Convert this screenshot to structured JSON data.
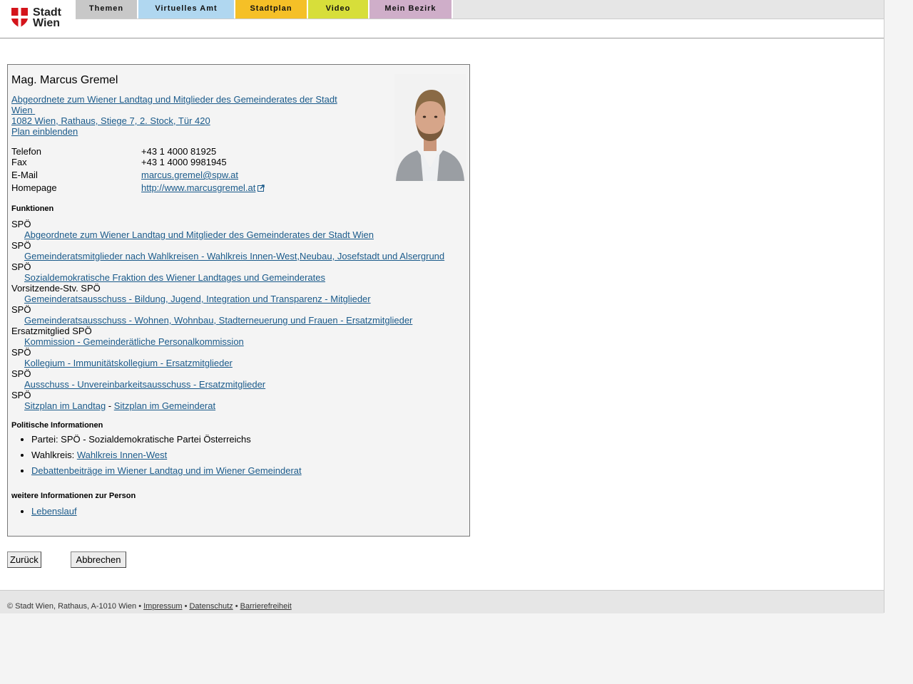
{
  "header": {
    "logo_text": "Stadt\nWien",
    "tabs": [
      {
        "label": "Themen",
        "color": "#c8c8c8"
      },
      {
        "label": "Virtuelles Amt",
        "color": "#b0d7f0"
      },
      {
        "label": "Stadtplan",
        "color": "#f5c027"
      },
      {
        "label": "Video",
        "color": "#d7de3a"
      },
      {
        "label": "Mein Bezirk",
        "color": "#cfaec9"
      }
    ]
  },
  "person": {
    "name": "Mag. Marcus Gremel",
    "title_line1": "Abgeordnete zum Wiener Landtag und Mitglieder des Gemeinderates der Stadt",
    "title_line2": "Wien",
    "address": "1082 Wien, Rathaus, Stiege 7, 2. Stock, Tür 420",
    "map_link": "Plan einblenden"
  },
  "contact": {
    "phone_label": "Telefon",
    "phone": "+43 1 4000 81925",
    "fax_label": "Fax",
    "fax": "+43 1 4000 9981945",
    "email_label": "E-Mail",
    "email": "marcus.gremel@spw.at",
    "homepage_label": "Homepage",
    "homepage": "http://www.marcusgremel.at"
  },
  "functions": {
    "heading": "Funktionen",
    "items": [
      {
        "role": "SPÖ",
        "link": "Abgeordnete zum Wiener Landtag und Mitglieder des Gemeinderates der Stadt Wien"
      },
      {
        "role": "SPÖ",
        "link": "Gemeinderatsmitglieder nach Wahlkreisen - Wahlkreis Innen-West,Neubau, Josefstadt und Alsergrund"
      },
      {
        "role": "SPÖ",
        "link": "Sozialdemokratische Fraktion des Wiener Landtages und Gemeinderates"
      },
      {
        "role": "Vorsitzende-Stv. SPÖ",
        "link": "Gemeinderatsausschuss - Bildung, Jugend, Integration und Transparenz - Mitglieder"
      },
      {
        "role": "SPÖ",
        "link": "Gemeinderatsausschuss - Wohnen, Wohnbau, Stadterneuerung und Frauen - Ersatzmitglieder"
      },
      {
        "role": "Ersatzmitglied SPÖ",
        "link": "Kommission - Gemeinderätliche Personalkommission"
      },
      {
        "role": "SPÖ",
        "link": "Kollegium - Immunitätskollegium - Ersatzmitglieder"
      },
      {
        "role": "SPÖ",
        "link": "Ausschuss - Unvereinbarkeitsausschuss - Ersatzmitglieder"
      }
    ],
    "last_role": "SPÖ",
    "seat_landtag": "Sitzplan im Landtag",
    "separator": " - ",
    "seat_gemeinderat": "Sitzplan im Gemeinderat"
  },
  "political": {
    "heading": "Politische Informationen",
    "party": "Partei: SPÖ - Sozialdemokratische Partei Österreichs",
    "district_label": "Wahlkreis: ",
    "district_link": "Wahlkreis Innen-West",
    "debates_link": "Debattenbeiträge im Wiener Landtag und im Wiener Gemeinderat"
  },
  "more": {
    "heading": "weitere Informationen zur Person",
    "cv_link": "Lebenslauf"
  },
  "buttons": {
    "back": "Zurück",
    "cancel": "Abbrechen"
  },
  "footer": {
    "copyright": "© Stadt Wien, Rathaus, A-1010 Wien",
    "bullet": " • ",
    "impressum": "Impressum",
    "datenschutz": "Datenschutz",
    "barrierefreiheit": "Barrierefreiheit"
  }
}
